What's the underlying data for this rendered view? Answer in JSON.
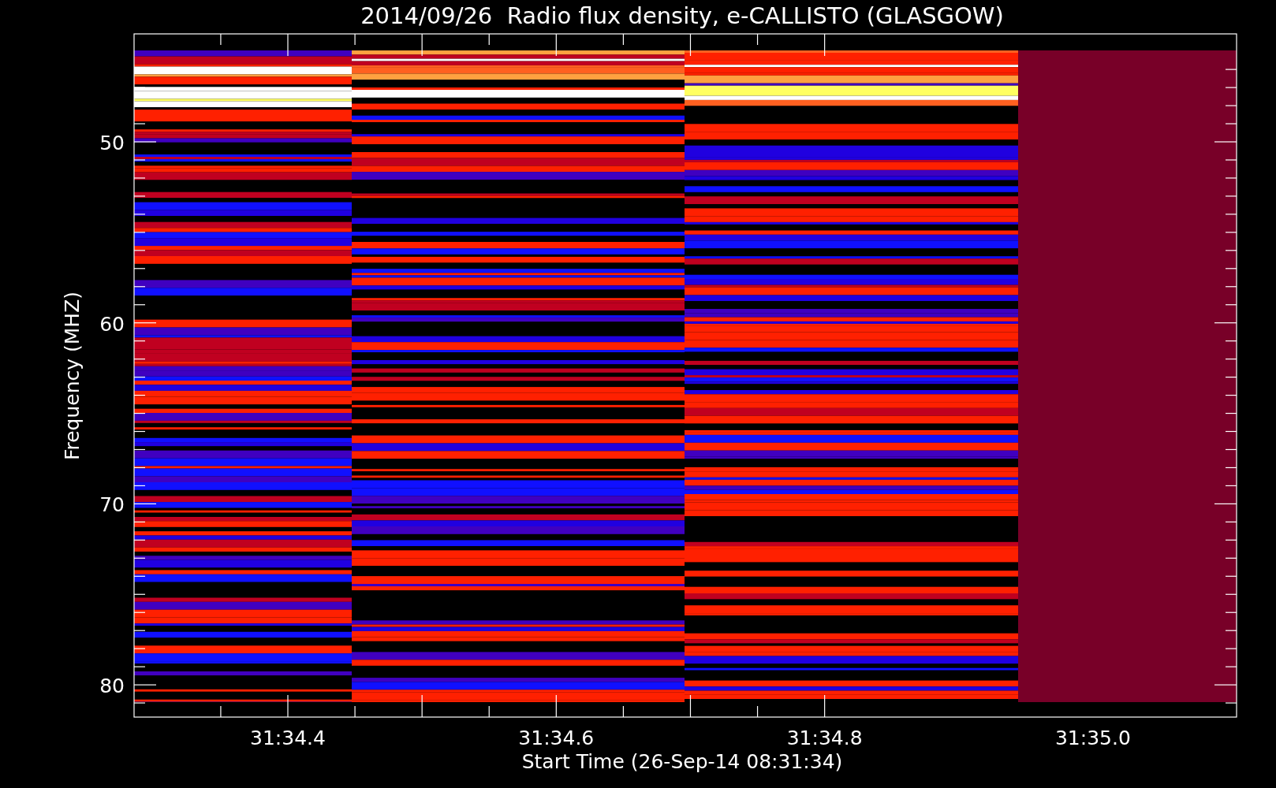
{
  "title": "2014/09/26  Radio flux density, e-CALLISTO (GLASGOW)",
  "y_axis": {
    "label": "Frequency (MHZ)",
    "ticks": [
      "50",
      "60",
      "70",
      "80"
    ]
  },
  "x_axis": {
    "label": "Start Time (26-Sep-14 08:31:34)",
    "ticks": [
      "31:34.4",
      "31:34.6",
      "31:34.8",
      "31:35.0"
    ]
  }
}
